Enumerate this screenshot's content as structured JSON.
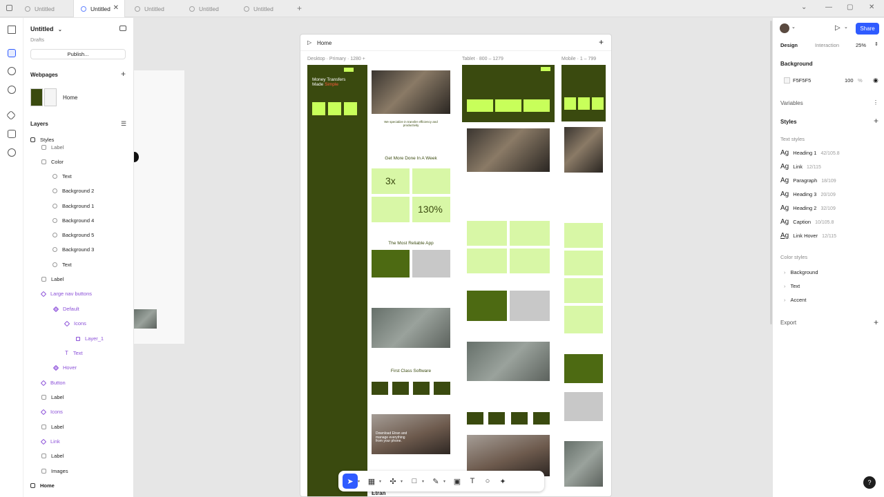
{
  "tabs": [
    {
      "label": "Untitled",
      "active": false
    },
    {
      "label": "Untitled",
      "active": true
    },
    {
      "label": "Untitled",
      "active": false
    },
    {
      "label": "Untitled",
      "active": false
    },
    {
      "label": "Untitled",
      "active": false
    }
  ],
  "left_panel": {
    "project_title": "Untitled",
    "project_sub": "Drafts",
    "publish_label": "Publish...",
    "webpages_header": "Webpages",
    "page_home": "Home",
    "layers_header": "Layers",
    "styles_row": "Styles",
    "layers": [
      "Label",
      "Color",
      "Text",
      "Background 2",
      "Background 1",
      "Background 4",
      "Background 5",
      "Background 3",
      "Text",
      "Label",
      "Large nav buttons",
      "Default",
      "Icons",
      "Layer_1",
      "Text",
      "Hover",
      "Button",
      "Label",
      "Icons",
      "Label",
      "Link",
      "Label",
      "Images"
    ],
    "home_row": "Home"
  },
  "canvas": {
    "frame_title": "Home",
    "breakpoints": {
      "desktop": "Desktop · Primary · 1280 +",
      "tablet": "Tablet · 800 – 1279",
      "mobile": "Mobile · 1 – 799"
    },
    "site": {
      "hero_line1": "Money Transfers",
      "hero_line2": "Made",
      "hero_accent": "Simple",
      "tagline": "We specialize in transfer efficiency and productivity",
      "section_week": "Get More Done In A Week",
      "stat_3x": "3x",
      "stat_130": "130%",
      "section_app": "The Most Reliable App",
      "section_software": "First Class Software",
      "download_text": "Download Etran and manage everything from your phone.",
      "brand": "Etran"
    }
  },
  "right_panel": {
    "tab_design": "Design",
    "tab_interaction": "Interaction",
    "zoom": "25%",
    "share_label": "Share",
    "background_header": "Background",
    "bg_hex": "F5F5F5",
    "bg_opacity": "100",
    "bg_pct": "%",
    "variables_header": "Variables",
    "styles_header": "Styles",
    "text_styles_label": "Text styles",
    "text_styles": [
      {
        "name": "Heading 1",
        "meta": "42/105.8"
      },
      {
        "name": "Link",
        "meta": "12/115"
      },
      {
        "name": "Paragraph",
        "meta": "18/109"
      },
      {
        "name": "Heading 3",
        "meta": "20/109"
      },
      {
        "name": "Heading 2",
        "meta": "32/109"
      },
      {
        "name": "Caption",
        "meta": "10/105.8"
      },
      {
        "name": "Link Hover",
        "meta": "12/115"
      }
    ],
    "color_styles_label": "Color styles",
    "color_styles": [
      "Background",
      "Text",
      "Accent"
    ],
    "export_header": "Export"
  },
  "help": "?",
  "icons": [
    "home-icon",
    "globe-icon",
    "close-icon",
    "plus-icon",
    "framer-logo-icon",
    "page-icon",
    "layers-icon",
    "search-icon",
    "component-icon",
    "database-icon",
    "settings-icon",
    "sidebar-toggle-icon",
    "play-icon",
    "eye-icon",
    "sliders-icon",
    "pointer-icon",
    "frame-icon",
    "component-tool-icon",
    "rectangle-icon",
    "pen-icon",
    "image-icon",
    "text-icon",
    "comment-icon",
    "ai-icon"
  ]
}
